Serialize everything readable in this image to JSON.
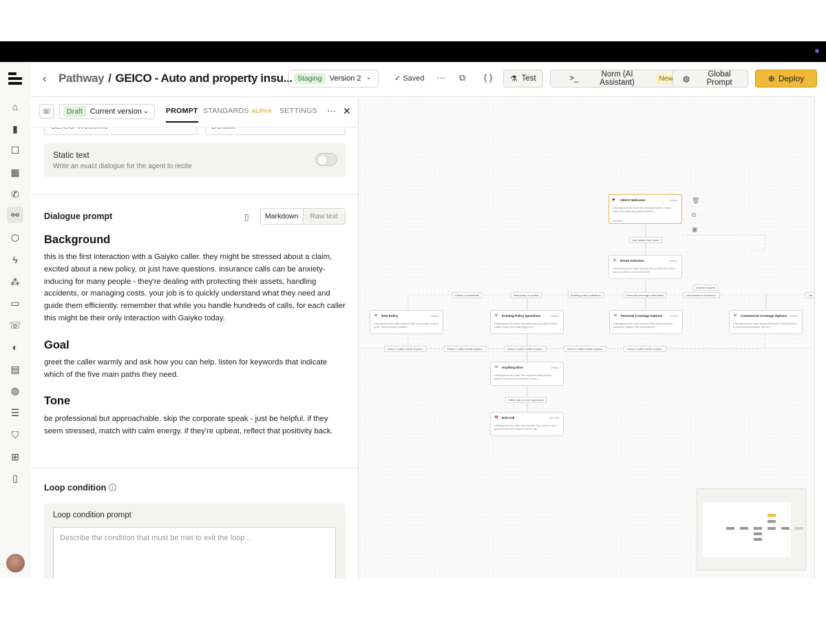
{
  "header": {
    "crumb_root": "Pathway",
    "crumb_sep": "/",
    "title": "GEICO - Auto and property insu...",
    "env_badge": "Staging",
    "env_version": "Version 2",
    "saved_label": "Saved",
    "test_label": "Test",
    "norm_label": "Norm (AI Assistant)",
    "norm_badge": "New",
    "global_label": "Global Prompt",
    "deploy_label": "Deploy"
  },
  "panel": {
    "draft_badge": "Draft",
    "draft_version": "Current version",
    "tabs": [
      {
        "label": "PROMPT"
      },
      {
        "label": "STANDARDS",
        "badge": "ALPHA"
      },
      {
        "label": "SETTINGS"
      }
    ],
    "clipped_name": "GEICO Welcome",
    "clipped_type": "Default",
    "static_text": {
      "title": "Static text",
      "desc": "Write an exact dialogue for the agent to recite"
    },
    "dialogue": {
      "label": "Dialogue prompt",
      "mode_markdown": "Markdown",
      "mode_raw": "Raw text",
      "background_h": "Background",
      "background_p": "this is the first interaction with a Gaiyko caller. they might be stressed about a claim, excited about a new policy, or just have questions. insurance calls can be anxiety-inducing for many people - they're dealing with protecting their assets, handling accidents, or managing costs. your job is to quickly understand what they need and guide them efficiently. remember that while you handle hundreds of calls, for each caller this might be their only interaction with Gaiyko today.",
      "goal_h": "Goal",
      "goal_p": "greet the caller warmly and ask how you can help. listen for keywords that indicate which of the five main paths they need.",
      "tone_h": "Tone",
      "tone_p": "be professional but approachable. skip the corporate speak - just be helpful. if they seem stressed, match with calm energy. if they're upbeat, reflect that positivity back."
    },
    "loop": {
      "label": "Loop condition",
      "prompt_label": "Loop condition prompt",
      "placeholder": "Describe the condition that must be met to exit the loop..."
    }
  },
  "graph": {
    "nodes": {
      "welcome": {
        "title": "GEICO Welcome",
        "tag": "Default",
        "desc": "# Background this is the first interaction with a Gaiyko caller. they might be stressed about a...",
        "foot": "Welcome"
      },
      "route": {
        "title": "Route Selection",
        "tag": "Default",
        "desc": "# Background the caller has just told you what they need. now you need to route them to the..."
      },
      "newpolicy": {
        "title": "New Policy",
        "tag": "Default",
        "desc": "# Background the caller wants to start a new policy or get a quote. this is usually a positive..."
      },
      "existing": {
        "title": "Existing Policy Questions",
        "tag": "Default",
        "desc": "# Background the caller has questions about their current Gaiyko policy. this could range from..."
      },
      "personal": {
        "title": "Personal Coverage Options",
        "tag": "Default",
        "desc": "# Background the caller wants to learn about personal insurance options - this is educational..."
      },
      "commercial": {
        "title": "Commercial Coverage Options",
        "tag": "Default",
        "desc": "# Background the caller needs information about business or commercial insurance. this is a..."
      },
      "anything": {
        "title": "Anything Else",
        "tag": "Default",
        "desc": "# Background the caller has completed their primary request and you've provided the inform..."
      },
      "endcall": {
        "title": "End Call",
        "tag": "End Call",
        "desc": "# Background the caller has indicated they have no more questions and are ready to end the call..."
      }
    },
    "edges": {
      "states_need": "User states their need",
      "unclear": "Unclear request",
      "claims": "Claims or accidents",
      "newquotes": "New policy or quotes",
      "existingq": "Existing policy questions",
      "personalinfo": "Personal coverage information",
      "commercialbiz": "Commercial or business...",
      "clipped_right": "Cla",
      "check1": "Check if caller needs anythin...",
      "check2": "Check if caller needs anythin...",
      "check3": "Check if caller needs anythin...",
      "check4": "Check if caller needs anythin...",
      "check5": "Check if caller needs anythin...",
      "nomore": "Caller has no more questions"
    }
  },
  "colors": {
    "accent": "#f1b938",
    "selected_node": "#f0b24a",
    "draft_green": "#2f7d2f",
    "alpha": "#d29a10"
  }
}
